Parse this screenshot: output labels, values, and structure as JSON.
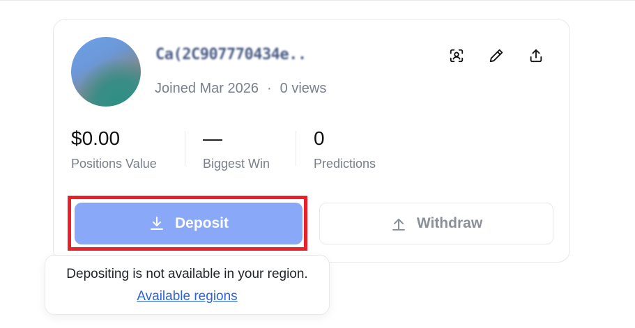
{
  "profile": {
    "username": "Ca(2C907770434e..",
    "joined": "Joined Mar 2026",
    "separator": "·",
    "views": "0 views"
  },
  "actions": {
    "icons": [
      "scan-face-icon",
      "pencil-icon",
      "share-upload-icon"
    ]
  },
  "stats": [
    {
      "value": "$0.00",
      "label": "Positions Value"
    },
    {
      "value": "—",
      "label": "Biggest Win"
    },
    {
      "value": "0",
      "label": "Predictions"
    }
  ],
  "buttons": {
    "deposit": "Deposit",
    "withdraw": "Withdraw"
  },
  "tooltip": {
    "message": "Depositing is not available in your region.",
    "link": "Available regions"
  },
  "colors": {
    "deposit_bg": "#89a8f8",
    "highlight": "#e8202a",
    "link": "#2e63d9"
  }
}
